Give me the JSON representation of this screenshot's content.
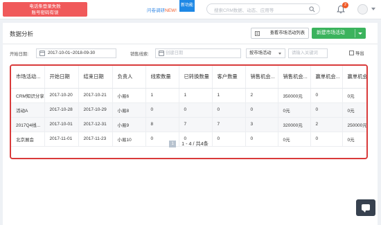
{
  "topbar": {
    "alert_line1": "电话条登录失败",
    "alert_line2": "账号密码有误",
    "survey_text": "问卷调研",
    "survey_new": "NEW!",
    "new_feature": "新功能",
    "search_placeholder": "搜索CRM数据、动态、应用等",
    "notification_count": "2"
  },
  "page": {
    "title": "数据分析",
    "view_list_button": "查看市场活动列表",
    "new_button": "新建市场活动"
  },
  "filters": {
    "start_date_label": "开始日期:",
    "start_date_value": "2017-10-01~2018-09-30",
    "sales_clue_label": "销售线索:",
    "sales_clue_placeholder": "创建日期",
    "sort_select": "按市场活动",
    "keyword_placeholder": "请输入关键词",
    "export_label": "导出"
  },
  "table": {
    "columns": [
      "市场活动...",
      "开始日期",
      "结束日期",
      "负责人",
      "线索数量",
      "已转换数量",
      "客户数量",
      "销售机会...",
      "销售机会...",
      "赢单机会...",
      "赢单机会..."
    ],
    "rows": [
      [
        "CRM知识分享",
        "2017-10-20",
        "2017-10-21",
        "小易6",
        "1",
        "1",
        "1",
        "2",
        "350000元",
        "0",
        "0元"
      ],
      [
        "活动A",
        "2017-10-28",
        "2017-10-29",
        "小易8",
        "0",
        "0",
        "0",
        "0",
        "0元",
        "0",
        "0元"
      ],
      [
        "2017Q4线...",
        "2017-10-01",
        "2017-12-31",
        "小易9",
        "8",
        "7",
        "7",
        "3",
        "320000元",
        "2",
        "250000元"
      ],
      [
        "北京展会",
        "2017-11-01",
        "2017-11-23",
        "小易10",
        "0",
        "0",
        "0",
        "0",
        "0元",
        "0",
        "0元"
      ]
    ]
  },
  "pagination": {
    "current_page": "1",
    "summary": "1 - 4 / 共4条"
  }
}
